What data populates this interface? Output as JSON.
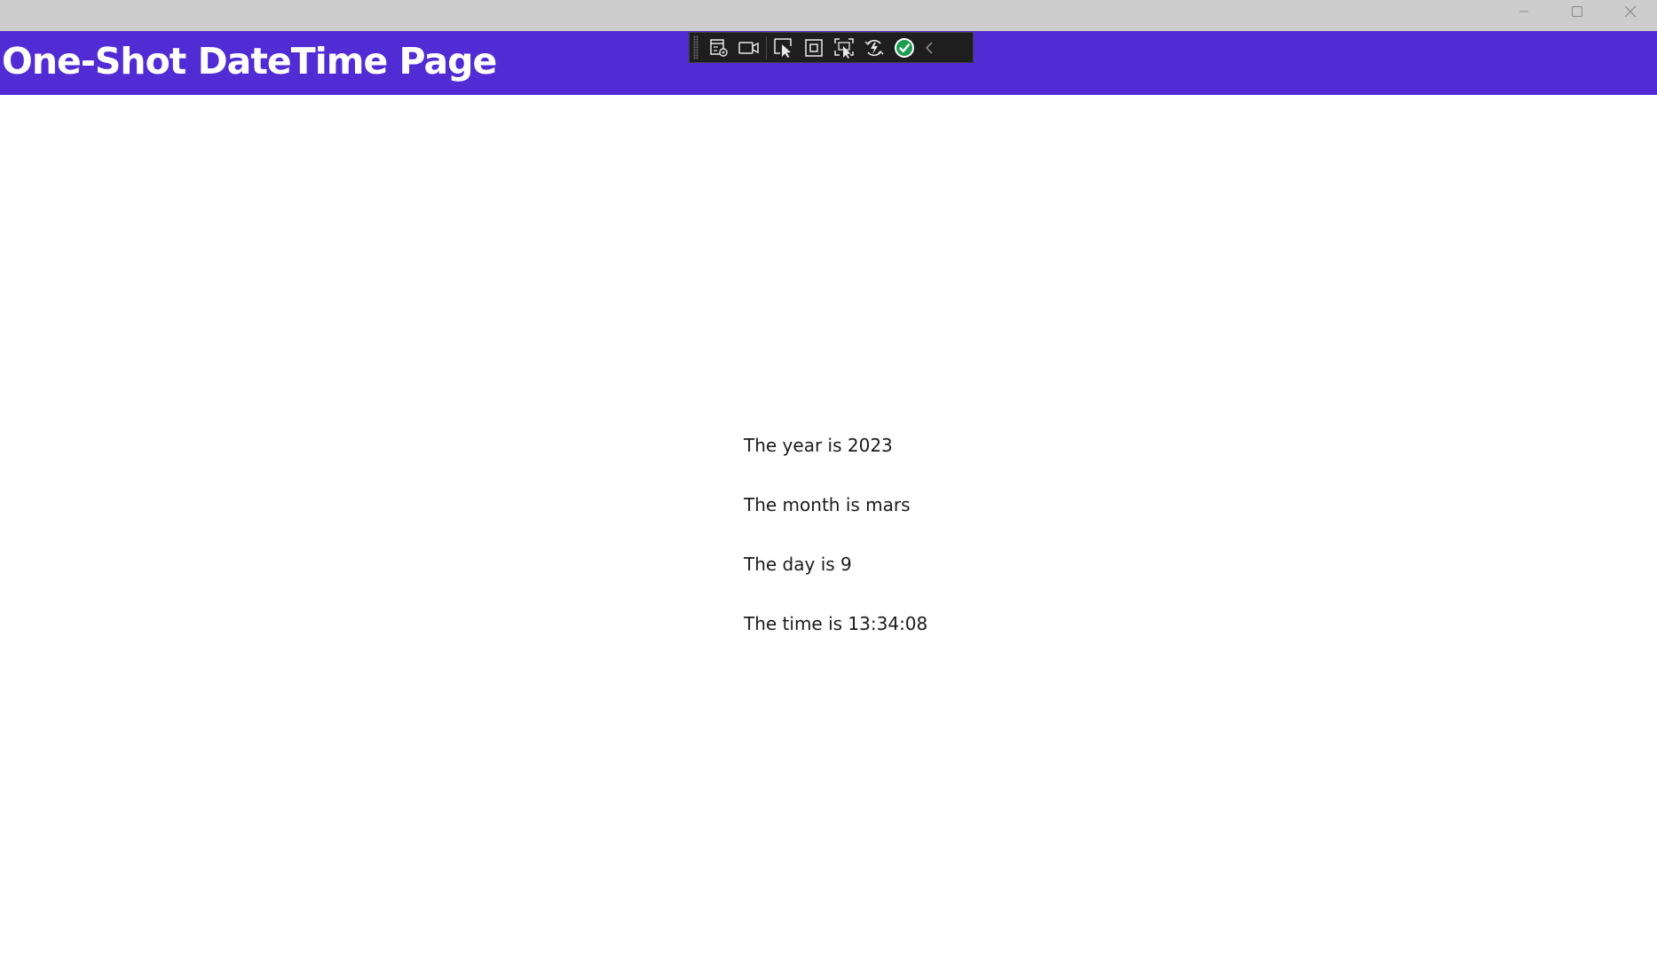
{
  "header": {
    "title": "One-Shot DateTime Page",
    "background_color": "#512bd4"
  },
  "window_controls": {
    "minimize_icon": "minimize-icon",
    "maximize_icon": "maximize-icon",
    "close_icon": "close-icon"
  },
  "debug_toolbar": {
    "icons": [
      "live-visual-tree-icon",
      "video-camera-icon",
      "select-element-icon",
      "display-layout-adorners-icon",
      "track-focus-icon",
      "hot-reload-icon",
      "check-circle-icon",
      "chevron-left-icon"
    ]
  },
  "content": {
    "year_line": "The year is 2023",
    "month_line": "The month is mars",
    "day_line": "The day is 9",
    "time_line": "The time is 13:34:08"
  }
}
